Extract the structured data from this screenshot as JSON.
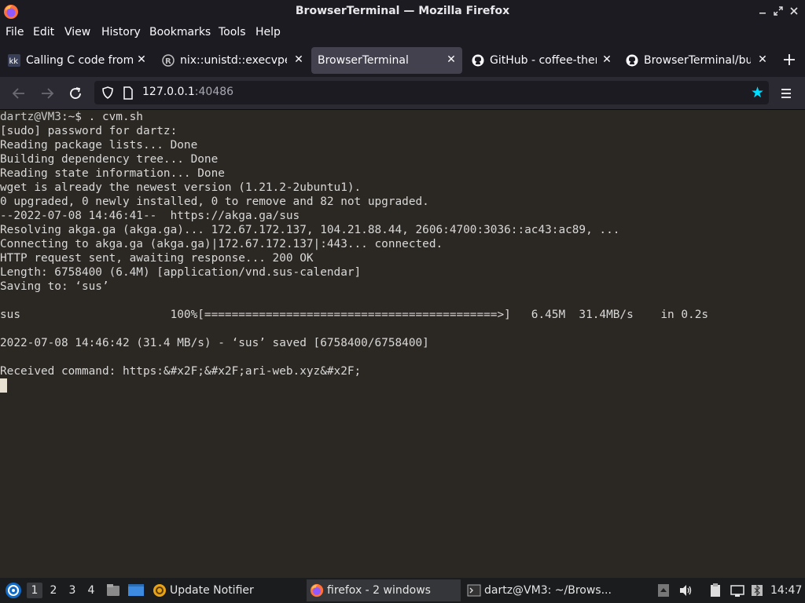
{
  "window": {
    "title": "BrowserTerminal — Mozilla Firefox"
  },
  "menu": [
    "File",
    "Edit",
    "View",
    "History",
    "Bookmarks",
    "Tools",
    "Help"
  ],
  "tabs": [
    {
      "label": "Calling C code from e",
      "icon": "kk-favicon"
    },
    {
      "label": "nix::unistd::execvpe",
      "icon": "rust-favicon"
    },
    {
      "label": "BrowserTerminal",
      "icon": "none",
      "active": true
    },
    {
      "label": "GitHub - coffee-them",
      "icon": "github-favicon"
    },
    {
      "label": "BrowserTerminal/buil",
      "icon": "github-favicon"
    }
  ],
  "tab_favicon_text": {
    "kk": "kk",
    "rust": "R"
  },
  "urlbar": {
    "host": "127.0.0.1",
    "port": ":40486"
  },
  "terminal": {
    "prompt_user": "dartz@VM3",
    "prompt_rest": ":~$ . cvm.sh",
    "lines": [
      "[sudo] password for dartz:",
      "Reading package lists... Done",
      "Building dependency tree... Done",
      "Reading state information... Done",
      "wget is already the newest version (1.21.2-2ubuntu1).",
      "0 upgraded, 0 newly installed, 0 to remove and 82 not upgraded.",
      "--2022-07-08 14:46:41--  https://akga.ga/sus",
      "Resolving akga.ga (akga.ga)... 172.67.172.137, 104.21.88.44, 2606:4700:3036::ac43:ac89, ...",
      "Connecting to akga.ga (akga.ga)|172.67.172.137|:443... connected.",
      "HTTP request sent, awaiting response... 200 OK",
      "Length: 6758400 (6.4M) [application/vnd.sus-calendar]",
      "Saving to: ‘sus’",
      "",
      "sus                      100%[===========================================>]   6.45M  31.4MB/s    in 0.2s",
      "",
      "2022-07-08 14:46:42 (31.4 MB/s) - ‘sus’ saved [6758400/6758400]",
      "",
      "Received command: https:&#x2F;&#x2F;ari-web.xyz&#x2F;"
    ]
  },
  "taskbar": {
    "workspaces": [
      "1",
      "2",
      "3",
      "4"
    ],
    "active_workspace": "1",
    "tasks": [
      {
        "label": "Update Notifier"
      },
      {
        "label": "firefox - 2 windows",
        "active": true
      },
      {
        "label": "dartz@VM3: ~/Brows..."
      }
    ],
    "clock": "14:47"
  },
  "colors": {
    "firefox_chrome": "#1c1b22",
    "navbar": "#2b2a33",
    "terminal_bg": "#2b2723",
    "terminal_fg": "#d9d9d9",
    "accent_star": "#00ddff"
  }
}
